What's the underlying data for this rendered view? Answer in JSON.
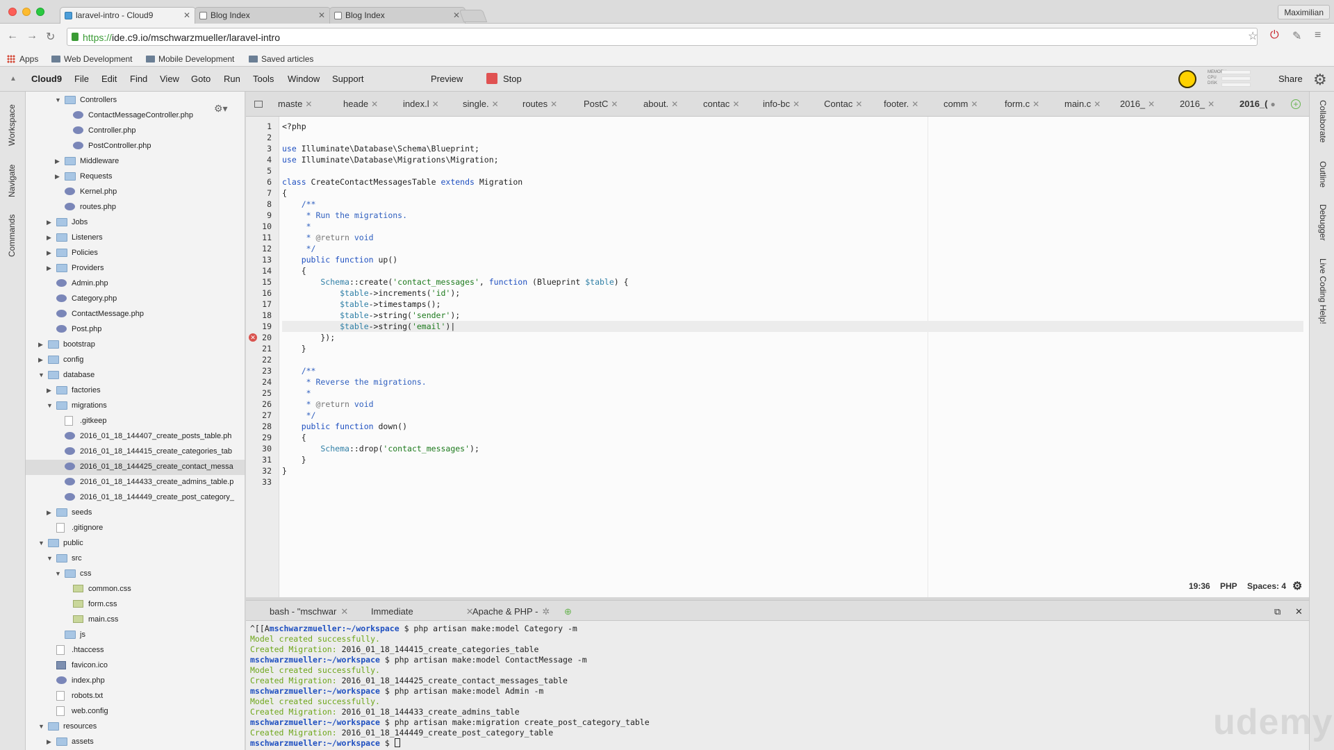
{
  "browser": {
    "tabs": [
      {
        "title": "laravel-intro - Cloud9",
        "active": true
      },
      {
        "title": "Blog Index",
        "active": false
      },
      {
        "title": "Blog Index",
        "active": false
      }
    ],
    "user": "Maximilian",
    "url_scheme": "https://",
    "url_rest": "ide.c9.io/mschwarzmueller/laravel-intro",
    "bookmarks": [
      "Apps",
      "Web Development",
      "Mobile Development",
      "Saved articles"
    ]
  },
  "menu": {
    "brand": "Cloud9",
    "items": [
      "File",
      "Edit",
      "Find",
      "View",
      "Goto",
      "Run",
      "Tools",
      "Window",
      "Support"
    ],
    "preview": "Preview",
    "stop": "Stop",
    "share": "Share",
    "meter_labels": [
      "MEMORY",
      "CPU",
      "DISK"
    ]
  },
  "left_panels": [
    "Workspace",
    "Navigate",
    "Commands"
  ],
  "right_panels": [
    "Collaborate",
    "Outline",
    "Debugger",
    "Live Coding Help!"
  ],
  "tree": [
    {
      "depth": 4,
      "type": "folder",
      "open": true,
      "label": "Controllers"
    },
    {
      "depth": 5,
      "type": "php",
      "label": "ContactMessageController.php"
    },
    {
      "depth": 5,
      "type": "php",
      "label": "Controller.php"
    },
    {
      "depth": 5,
      "type": "php",
      "label": "PostController.php"
    },
    {
      "depth": 4,
      "type": "folder",
      "open": false,
      "label": "Middleware"
    },
    {
      "depth": 4,
      "type": "folder",
      "open": false,
      "label": "Requests"
    },
    {
      "depth": 4,
      "type": "php",
      "label": "Kernel.php"
    },
    {
      "depth": 4,
      "type": "php",
      "label": "routes.php"
    },
    {
      "depth": 3,
      "type": "folder",
      "open": false,
      "label": "Jobs"
    },
    {
      "depth": 3,
      "type": "folder",
      "open": false,
      "label": "Listeners"
    },
    {
      "depth": 3,
      "type": "folder",
      "open": false,
      "label": "Policies"
    },
    {
      "depth": 3,
      "type": "folder",
      "open": false,
      "label": "Providers"
    },
    {
      "depth": 3,
      "type": "php",
      "label": "Admin.php"
    },
    {
      "depth": 3,
      "type": "php",
      "label": "Category.php"
    },
    {
      "depth": 3,
      "type": "php",
      "label": "ContactMessage.php"
    },
    {
      "depth": 3,
      "type": "php",
      "label": "Post.php"
    },
    {
      "depth": 2,
      "type": "folder",
      "open": false,
      "label": "bootstrap"
    },
    {
      "depth": 2,
      "type": "folder",
      "open": false,
      "label": "config"
    },
    {
      "depth": 2,
      "type": "folder",
      "open": true,
      "label": "database"
    },
    {
      "depth": 3,
      "type": "folder",
      "open": false,
      "label": "factories"
    },
    {
      "depth": 3,
      "type": "folder",
      "open": true,
      "label": "migrations"
    },
    {
      "depth": 4,
      "type": "file",
      "label": ".gitkeep"
    },
    {
      "depth": 4,
      "type": "php",
      "label": "2016_01_18_144407_create_posts_table.ph"
    },
    {
      "depth": 4,
      "type": "php",
      "label": "2016_01_18_144415_create_categories_tab"
    },
    {
      "depth": 4,
      "type": "php",
      "label": "2016_01_18_144425_create_contact_messa",
      "selected": true
    },
    {
      "depth": 4,
      "type": "php",
      "label": "2016_01_18_144433_create_admins_table.p"
    },
    {
      "depth": 4,
      "type": "php",
      "label": "2016_01_18_144449_create_post_category_"
    },
    {
      "depth": 3,
      "type": "folder",
      "open": false,
      "label": "seeds"
    },
    {
      "depth": 3,
      "type": "file",
      "label": ".gitignore"
    },
    {
      "depth": 2,
      "type": "folder",
      "open": true,
      "label": "public"
    },
    {
      "depth": 3,
      "type": "folder",
      "open": true,
      "label": "src"
    },
    {
      "depth": 4,
      "type": "folder",
      "open": true,
      "label": "css"
    },
    {
      "depth": 5,
      "type": "css",
      "label": "common.css"
    },
    {
      "depth": 5,
      "type": "css",
      "label": "form.css"
    },
    {
      "depth": 5,
      "type": "css",
      "label": "main.css"
    },
    {
      "depth": 4,
      "type": "folder",
      "leaf": true,
      "label": "js"
    },
    {
      "depth": 3,
      "type": "file",
      "label": ".htaccess"
    },
    {
      "depth": 3,
      "type": "img",
      "label": "favicon.ico"
    },
    {
      "depth": 3,
      "type": "php",
      "label": "index.php"
    },
    {
      "depth": 3,
      "type": "file",
      "label": "robots.txt"
    },
    {
      "depth": 3,
      "type": "file",
      "label": "web.config"
    },
    {
      "depth": 2,
      "type": "folder",
      "open": true,
      "label": "resources"
    },
    {
      "depth": 3,
      "type": "folder",
      "open": false,
      "label": "assets"
    }
  ],
  "editor_tabs": [
    "maste",
    "heade",
    "index.l",
    "single.",
    "routes",
    "PostC",
    "about.",
    "contac",
    "info-bc",
    "Contac",
    "footer.",
    "comm",
    "form.c",
    "main.c",
    "2016_",
    "2016_",
    "2016_("
  ],
  "code": [
    [
      [
        "p",
        "<?php"
      ]
    ],
    [],
    [
      [
        "k",
        "use "
      ],
      [
        "p",
        "Illuminate\\Database\\Schema\\Blueprint;"
      ]
    ],
    [
      [
        "k",
        "use "
      ],
      [
        "p",
        "Illuminate\\Database\\Migrations\\Migration;"
      ]
    ],
    [],
    [
      [
        "k",
        "class "
      ],
      [
        "p",
        "CreateContactMessagesTable "
      ],
      [
        "k",
        "extends "
      ],
      [
        "p",
        "Migration"
      ]
    ],
    [
      [
        "p",
        "{"
      ]
    ],
    [
      [
        "c",
        "    /**"
      ]
    ],
    [
      [
        "c",
        "     * Run the migrations."
      ]
    ],
    [
      [
        "c",
        "     *"
      ]
    ],
    [
      [
        "c",
        "     * "
      ],
      [
        "cm",
        "@return"
      ],
      [
        "c",
        " void"
      ]
    ],
    [
      [
        "c",
        "     */"
      ]
    ],
    [
      [
        "k",
        "    public function "
      ],
      [
        "p",
        "up()"
      ]
    ],
    [
      [
        "p",
        "    {"
      ]
    ],
    [
      [
        "v",
        "        Schema"
      ],
      [
        "p",
        "::create("
      ],
      [
        "s",
        "'contact_messages'"
      ],
      [
        "p",
        ", "
      ],
      [
        "k",
        "function "
      ],
      [
        "p",
        "(Blueprint "
      ],
      [
        "v",
        "$table"
      ],
      [
        "p",
        ") {"
      ]
    ],
    [
      [
        "v",
        "            $table"
      ],
      [
        "p",
        "->increments("
      ],
      [
        "s",
        "'id'"
      ],
      [
        "p",
        ");"
      ]
    ],
    [
      [
        "v",
        "            $table"
      ],
      [
        "p",
        "->timestamps();"
      ]
    ],
    [
      [
        "v",
        "            $table"
      ],
      [
        "p",
        "->string("
      ],
      [
        "s",
        "'sender'"
      ],
      [
        "p",
        ");"
      ]
    ],
    [
      [
        "v",
        "            $table"
      ],
      [
        "p",
        "->string("
      ],
      [
        "s",
        "'email'"
      ],
      [
        "p",
        ")|"
      ]
    ],
    [
      [
        "p",
        "        });"
      ]
    ],
    [
      [
        "p",
        "    }"
      ]
    ],
    [],
    [
      [
        "c",
        "    /**"
      ]
    ],
    [
      [
        "c",
        "     * Reverse the migrations."
      ]
    ],
    [
      [
        "c",
        "     *"
      ]
    ],
    [
      [
        "c",
        "     * "
      ],
      [
        "cm",
        "@return"
      ],
      [
        "c",
        " void"
      ]
    ],
    [
      [
        "c",
        "     */"
      ]
    ],
    [
      [
        "k",
        "    public function "
      ],
      [
        "p",
        "down()"
      ]
    ],
    [
      [
        "p",
        "    {"
      ]
    ],
    [
      [
        "v",
        "        Schema"
      ],
      [
        "p",
        "::drop("
      ],
      [
        "s",
        "'contact_messages'"
      ],
      [
        "p",
        ");"
      ]
    ],
    [
      [
        "p",
        "    }"
      ]
    ],
    [
      [
        "p",
        "}"
      ]
    ],
    []
  ],
  "error_line": 20,
  "current_line": 19,
  "status": {
    "position": "19:36",
    "language": "PHP",
    "spaces": "Spaces: 4"
  },
  "terminal_tabs": [
    "bash - \"mschwar",
    "Immediate",
    "Apache & PHP -"
  ],
  "terminal": [
    [
      [
        "plain",
        "^[[A"
      ],
      [
        "usr",
        "mschwarzmueller:~/workspace"
      ],
      [
        "plain",
        " $ php artisan make:model Category -m"
      ]
    ],
    [
      [
        "ok",
        "Model created successfully."
      ]
    ],
    [
      [
        "ok",
        "Created Migration: "
      ],
      [
        "plain",
        "2016_01_18_144415_create_categories_table"
      ]
    ],
    [
      [
        "usr",
        "mschwarzmueller:~/workspace"
      ],
      [
        "plain",
        " $ php artisan make:model ContactMessage -m"
      ]
    ],
    [
      [
        "ok",
        "Model created successfully."
      ]
    ],
    [
      [
        "ok",
        "Created Migration: "
      ],
      [
        "plain",
        "2016_01_18_144425_create_contact_messages_table"
      ]
    ],
    [
      [
        "usr",
        "mschwarzmueller:~/workspace"
      ],
      [
        "plain",
        " $ php artisan make:model Admin -m"
      ]
    ],
    [
      [
        "ok",
        "Model created successfully."
      ]
    ],
    [
      [
        "ok",
        "Created Migration: "
      ],
      [
        "plain",
        "2016_01_18_144433_create_admins_table"
      ]
    ],
    [
      [
        "usr",
        "mschwarzmueller:~/workspace"
      ],
      [
        "plain",
        " $ php artisan make:migration create_post_category_table"
      ]
    ],
    [
      [
        "ok",
        "Created Migration: "
      ],
      [
        "plain",
        "2016_01_18_144449_create_post_category_table"
      ]
    ],
    [
      [
        "usr",
        "mschwarzmueller:~/workspace"
      ],
      [
        "plain",
        " $ "
      ]
    ]
  ],
  "watermark": "udemy"
}
